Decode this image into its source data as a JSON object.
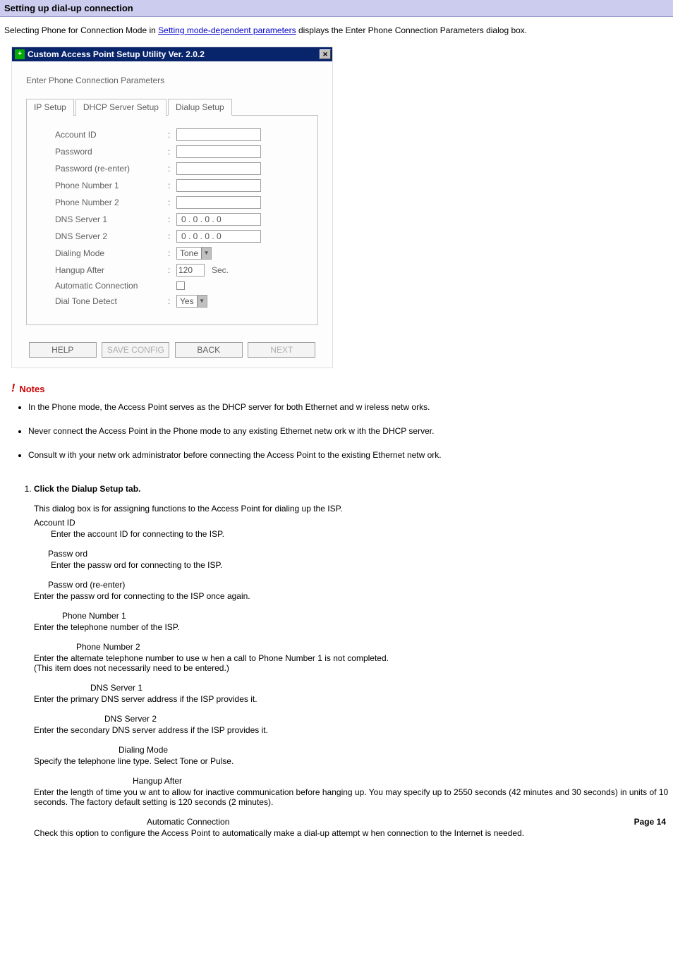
{
  "section_title": "Setting up dial-up connection",
  "intro_before": "Selecting Phone for Connection Mode in ",
  "intro_link": "Setting mode-dependent parameters",
  "intro_after": " displays the Enter Phone Connection Parameters dialog box.",
  "dialog": {
    "title": "Custom Access Point Setup Utility  Ver.  2.0.2",
    "subtitle": "Enter Phone Connection Parameters",
    "tabs": [
      "IP Setup",
      "DHCP Server Setup",
      "Dialup Setup"
    ],
    "active_tab": 2,
    "fields": {
      "account_id": "Account ID",
      "password": "Password",
      "password_re": "Password (re-enter)",
      "phone1": "Phone Number 1",
      "phone2": "Phone Number 2",
      "dns1": "DNS Server 1",
      "dns2": "DNS Server 2",
      "dialing_mode": "Dialing Mode",
      "hangup_after": "Hangup After",
      "auto_conn": "Automatic Connection",
      "dial_tone": "Dial Tone Detect"
    },
    "values": {
      "dns1": "0  .  0  .  0  .  0",
      "dns2": "0  .  0  .  0  .  0",
      "dialing_mode": "Tone",
      "hangup_after": "120",
      "hangup_unit": "Sec.",
      "dial_tone": "Yes"
    },
    "buttons": {
      "help": "HELP",
      "save": "SAVE CONFIG",
      "back": "BACK",
      "next": "NEXT"
    }
  },
  "notes_label": "Notes",
  "notes": [
    "In the Phone mode, the Access Point serves as the DHCP server for both Ethernet and w ireless netw orks.",
    "Never connect the Access Point in the Phone mode to any existing Ethernet netw ork w ith the DHCP server.",
    "Consult w ith your netw ork administrator before connecting the Access Point to the existing Ethernet netw ork."
  ],
  "step1_title": "Click the Dialup Setup tab.",
  "step1_intro": "This dialog box is for assigning functions to the Access Point for dialing up the ISP.",
  "defs": {
    "account_id": {
      "name": "Account ID",
      "desc": "Enter the account ID for connecting to the ISP."
    },
    "password": {
      "name": "Passw ord",
      "desc": "Enter the passw ord for connecting to the ISP."
    },
    "password_re": {
      "name": "Passw ord (re-enter)",
      "desc": "Enter the passw ord for connecting to the ISP once again."
    },
    "phone1": {
      "name": "Phone Number 1",
      "desc": "Enter the telephone number of the ISP."
    },
    "phone2": {
      "name": "Phone Number 2",
      "desc1": "Enter the alternate telephone number to use w hen a call to Phone Number 1 is not completed.",
      "desc2": "(This item does not necessarily need to be entered.)"
    },
    "dns1": {
      "name": "DNS Server 1",
      "desc": "Enter the primary DNS server address if the ISP provides it."
    },
    "dns2": {
      "name": "DNS Server 2",
      "desc": "Enter the secondary DNS server address if the ISP provides it."
    },
    "dialing": {
      "name": "Dialing Mode",
      "desc": "Specify the telephone line type. Select Tone or Pulse."
    },
    "hangup": {
      "name": "Hangup After",
      "desc": "Enter the length of time you w ant to allow  for inactive communication before hanging up. You may specify up to 2550 seconds (42 minutes and 30 seconds) in units of 10 seconds. The factory default setting is 120 seconds (2 minutes)."
    },
    "auto": {
      "name": "Automatic Connection",
      "desc": "Check this option to configure the Access Point to automatically make a dial-up attempt w hen connection to the Internet is needed."
    }
  },
  "page_label": "Page 14"
}
